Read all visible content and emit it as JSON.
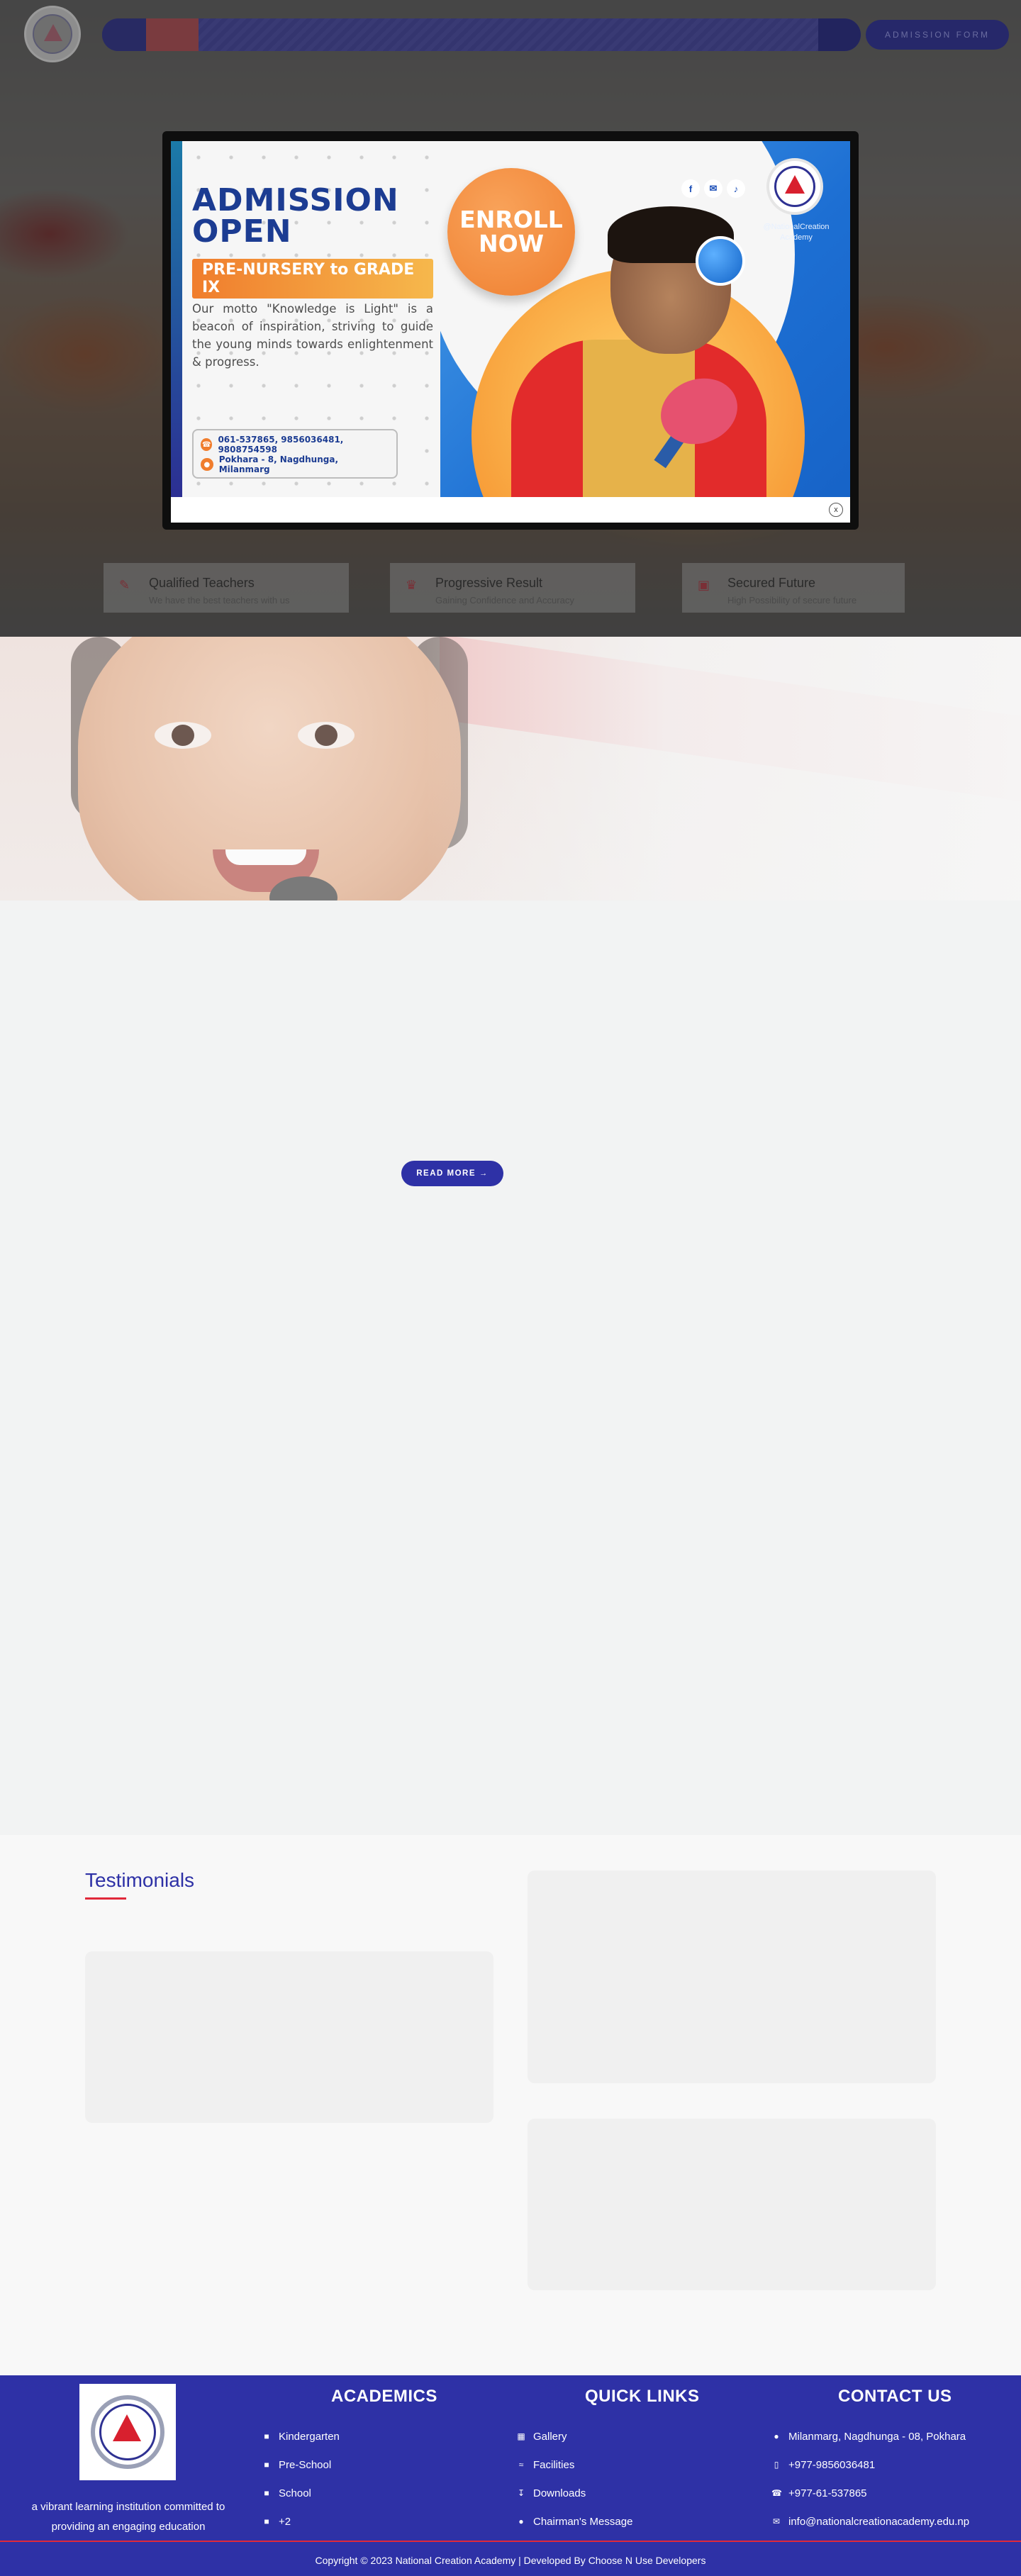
{
  "header": {
    "admission_button": "ADMISSION FORM"
  },
  "features": [
    {
      "icon": "teacher-icon",
      "title": "Qualified Teachers",
      "desc": "We have the best teachers with us"
    },
    {
      "icon": "trophy-icon",
      "title": "Progressive Result",
      "desc": "Gaining Confidence and Accuracy"
    },
    {
      "icon": "briefcase-icon",
      "title": "Secured Future",
      "desc": "High Possibility of secure future"
    }
  ],
  "popup": {
    "title_line1": "ADMISSION",
    "title_line2": "OPEN",
    "grade": "PRE-NURSERY to GRADE IX",
    "motto": "Our motto \"Knowledge is Light\" is a beacon of inspiration, striving to guide the young minds towards enlightenment & progress.",
    "phones": "061-537865, 9856036481, 9808754598",
    "address": "Pokhara - 8, Nagdhunga, Milanmarg",
    "enroll_line1": "ENROLL",
    "enroll_line2": "NOW",
    "handle": "@NationalCreation Academy",
    "social": [
      "f",
      "✉",
      "♪"
    ],
    "close": "x"
  },
  "about": {
    "read_more": "READ MORE →"
  },
  "testimonials": {
    "title": "Testimonials"
  },
  "footer": {
    "description": "a vibrant learning institution committed to providing an engaging education",
    "academics_title": "ACADEMICS",
    "academics": [
      "Kindergarten",
      "Pre-School",
      "School",
      "+2"
    ],
    "quick_links_title": "QUICK LINKS",
    "quick_links": [
      "Gallery",
      "Facilities",
      "Downloads",
      "Chairman's Message"
    ],
    "contact_title": "CONTACT US",
    "contact": [
      "Milanmarg, Nagdhunga - 08, Pokhara",
      "+977-9856036481",
      "+977-61-537865",
      "info@nationalcreationacademy.edu.np"
    ],
    "copyright": "Copyright © 2023 National Creation Academy | Developed By Choose N Use Developers"
  },
  "colors": {
    "brand_blue": "#2e31a6",
    "accent_red": "#e0293a",
    "banner_orange": "#f07d2d"
  }
}
